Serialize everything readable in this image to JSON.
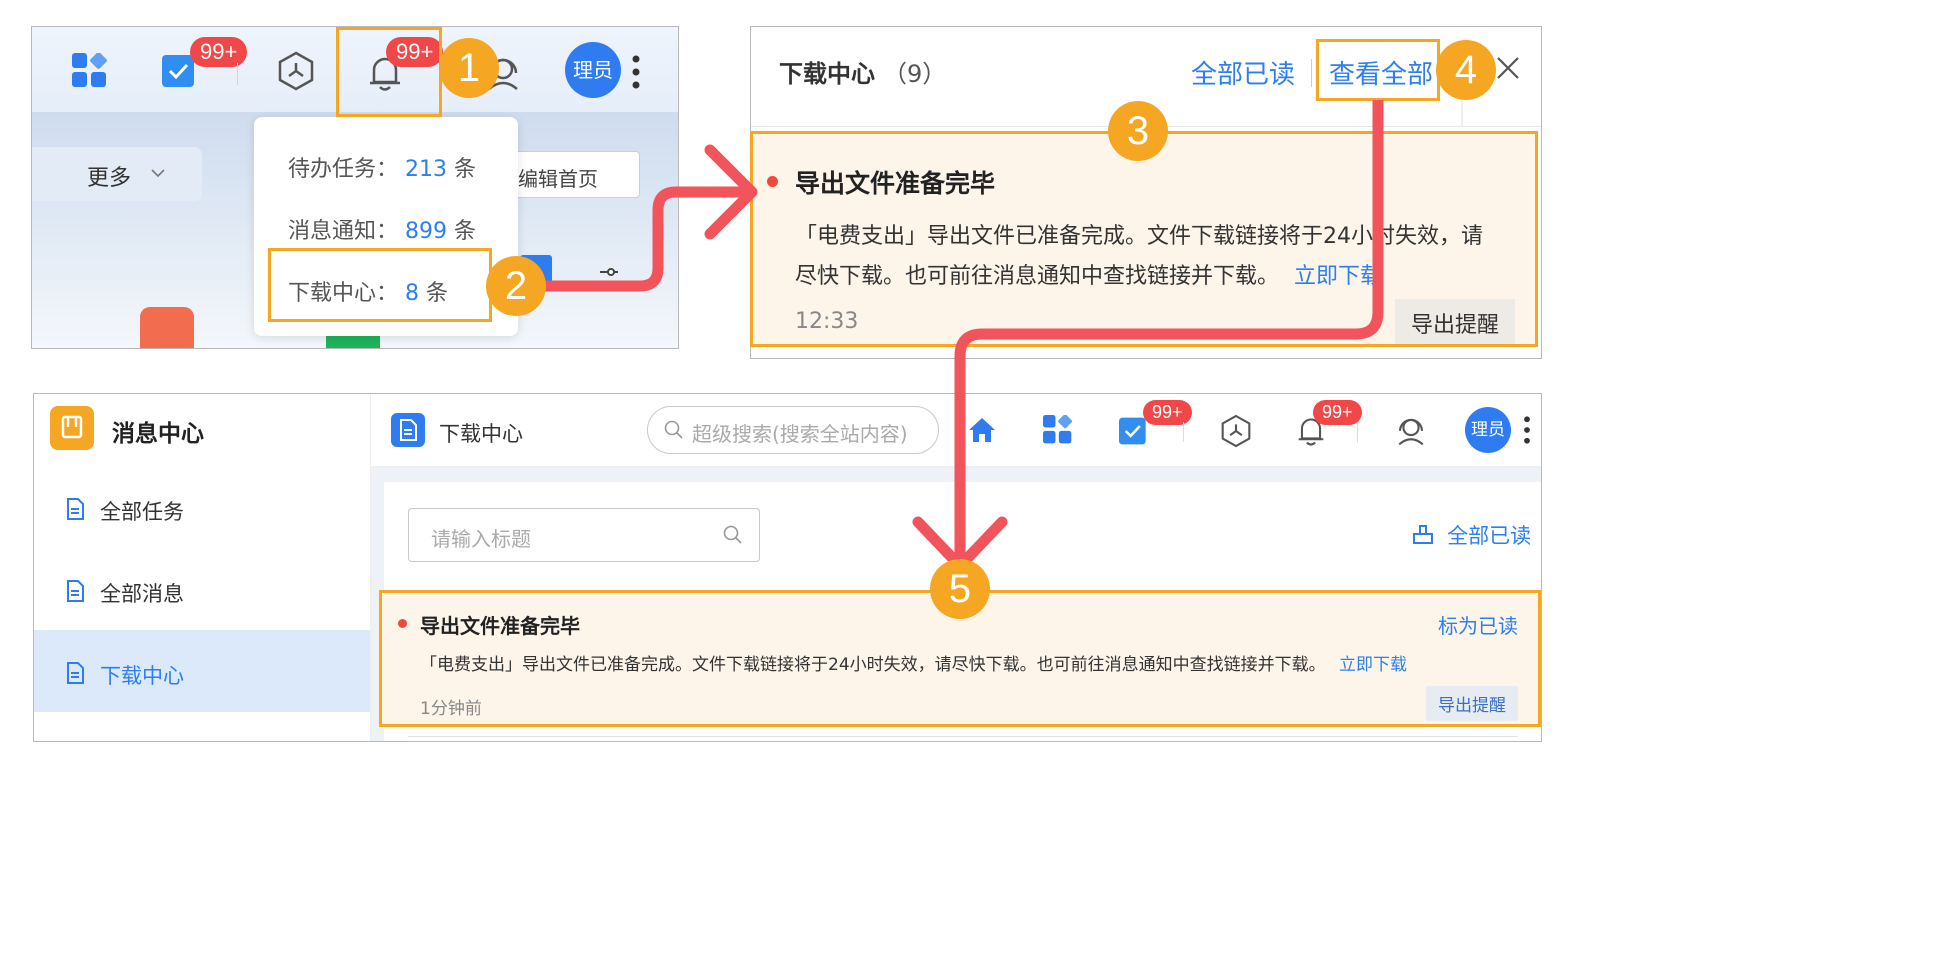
{
  "panel1": {
    "todo_badge": "99+",
    "bell_badge": "99+",
    "avatar_text": "理员",
    "more_label": "更多",
    "edit_home": "编辑首页",
    "dropdown": {
      "items": [
        {
          "label": "待办任务：",
          "count": "213",
          "unit": "条"
        },
        {
          "label": "消息通知：",
          "count": "899",
          "unit": "条"
        },
        {
          "label": "下载中心：",
          "count": "8",
          "unit": "条"
        }
      ]
    }
  },
  "panel2": {
    "title": "下载中心",
    "count": "（9）",
    "mark_all_read": "全部已读",
    "view_all": "查看全部",
    "notice": {
      "title": "导出文件准备完毕",
      "body_line1": "「电费支出」导出文件已准备完成。文件下载链接将于24小时失效，请",
      "body_line2": "尽快下载。也可前往消息通知中查找链接并下载。",
      "link": "立即下载",
      "time": "12:33",
      "tag": "导出提醒"
    }
  },
  "panel3": {
    "app_title": "消息中心",
    "sidebar": [
      "全部任务",
      "全部消息",
      "下载中心"
    ],
    "header_title": "下载中心",
    "search_placeholder": "超级搜索(搜索全站内容)",
    "todo_badge": "99+",
    "bell_badge": "99+",
    "avatar_text": "理员",
    "title_input_placeholder": "请输入标题",
    "mark_all_read": "全部已读",
    "notice": {
      "title": "导出文件准备完毕",
      "mark_read": "标为已读",
      "body": "「电费支出」导出文件已准备完成。文件下载链接将于24小时失效，请尽快下载。也可前往消息通知中查找链接并下载。",
      "link": "立即下载",
      "time": "1分钟前",
      "tag": "导出提醒"
    }
  },
  "steps": [
    "1",
    "2",
    "3",
    "4",
    "5"
  ],
  "colors": {
    "accent_orange": "#f5a623",
    "arrow_red": "#f2545b",
    "link_blue": "#2d7ff0",
    "badge_red": "#f04848"
  }
}
